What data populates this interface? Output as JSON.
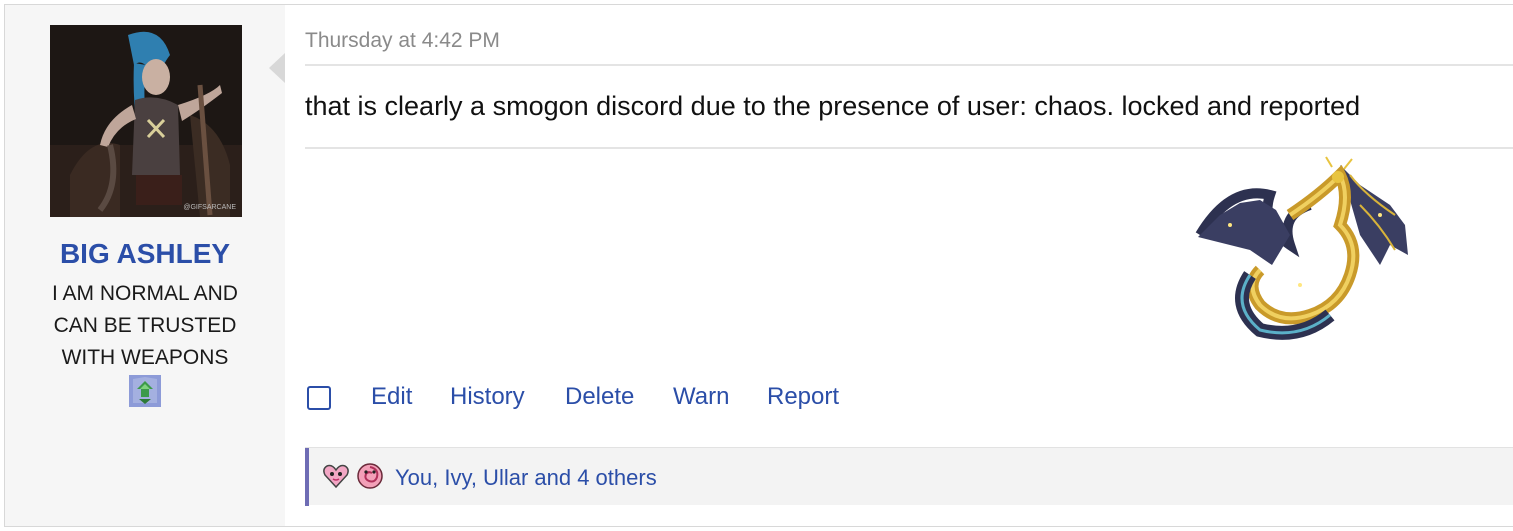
{
  "user": {
    "name": "BIG ASHLEY",
    "title_lines": [
      "I AM NORMAL AND",
      "CAN BE TRUSTED",
      "WITH WEAPONS"
    ],
    "avatar_watermark": "@GIFSARCANE",
    "avatar_icon": "user-avatar-image",
    "badge_icon": "green-sprite-badge-icon"
  },
  "post": {
    "timestamp": "Thursday at 4:42 PM",
    "message": "that is clearly a smogon discord due to the presence of user: chaos. locked and reported",
    "signature_icon": "gold-dragon-signature-image"
  },
  "actions": {
    "edit": "Edit",
    "history": "History",
    "delete": "Delete",
    "warn": "Warn",
    "report": "Report"
  },
  "reactions": {
    "summary": "You, Ivy, Ullar and 4 others",
    "icons": [
      "pink-heart-sprite-icon",
      "pink-swirl-sprite-icon"
    ]
  },
  "colors": {
    "link": "#2b4ea8",
    "accent": "#6e6cb4",
    "sidebar_bg": "#f6f6f6"
  }
}
